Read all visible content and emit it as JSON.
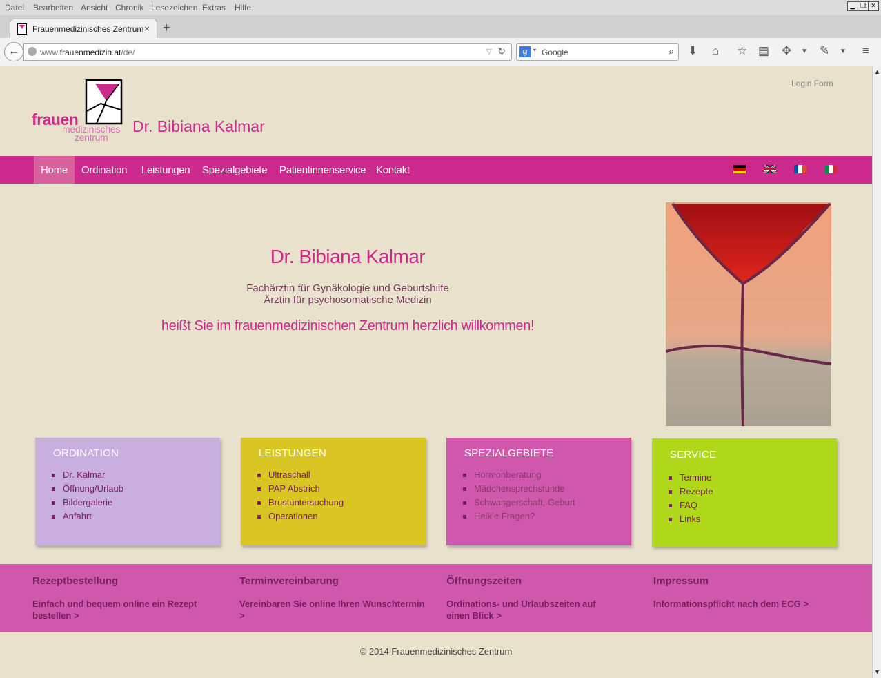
{
  "browser": {
    "menu": [
      "Datei",
      "Bearbeiten",
      "Ansicht",
      "Chronik",
      "Lesezeichen",
      "Extras",
      "Hilfe"
    ],
    "tab_title": "Frauenmedizinisches Zentrum",
    "url_prefix": "www.",
    "url_domain": "frauenmedizin.at",
    "url_path": "/de/",
    "search_placeholder": "Google",
    "search_engine_icon": "google-icon"
  },
  "header": {
    "logo_line1": "frauen",
    "logo_line2": "medizinisches",
    "logo_line3": "zentrum",
    "site_name": "Dr. Bibiana Kalmar",
    "login_link": "Login Form"
  },
  "nav": {
    "items": [
      "Home",
      "Ordination",
      "Leistungen",
      "Spezialgebiete",
      "Patientinnenservice",
      "Kontakt"
    ],
    "active": "Home",
    "flags": [
      "de",
      "en",
      "fr",
      "it"
    ]
  },
  "hero": {
    "title": "Dr. Bibiana Kalmar",
    "subtitle1": "Fachärztin für Gynäkologie und Geburtshilfe",
    "subtitle2": "Ärztin für psychosomatische Medizin",
    "welcome": "heißt Sie im frauenmedizinischen Zentrum herzlich willkommen!"
  },
  "boxes": [
    {
      "title": "ORDINATION",
      "color": "#c9aee0",
      "links": [
        "Dr. Kalmar",
        "Öffnung/Urlaub",
        "Bildergalerie",
        "Anfahrt"
      ]
    },
    {
      "title": "LEISTUNGEN",
      "color": "#d9c625",
      "links": [
        "Ultraschall",
        "PAP Abstrich",
        "Brustuntersuchung",
        "Operationen"
      ]
    },
    {
      "title": "SPEZIALGEBIETE",
      "color": "#cf58ac",
      "links": [
        "Hormonberatung",
        "Mädchensprechstunde",
        "Schwangerschaft, Geburt",
        "Heikle Fragen?"
      ]
    },
    {
      "title": "SERVICE",
      "color": "#b0d81a",
      "links": [
        "Termine",
        "Rezepte",
        "FAQ",
        "Links"
      ]
    }
  ],
  "footer": {
    "columns": [
      {
        "title": "Rezeptbestellung",
        "text": "Einfach und bequem online ein Rezept bestellen >"
      },
      {
        "title": "Terminvereinbarung",
        "text": "Vereinbaren Sie online Ihren Wunschtermin >"
      },
      {
        "title": "Öffnungszeiten",
        "text": "Ordinations- und Urlaubszeiten auf einen Blick >"
      },
      {
        "title": "Impressum",
        "text": "Informationspflicht nach dem ECG >"
      }
    ],
    "copyright": "© 2014  Frauenmedizinisches Zentrum"
  },
  "colors": {
    "brand": "#cc2a8c",
    "background": "#e8e1cc",
    "footer_band": "#cf58ac"
  }
}
